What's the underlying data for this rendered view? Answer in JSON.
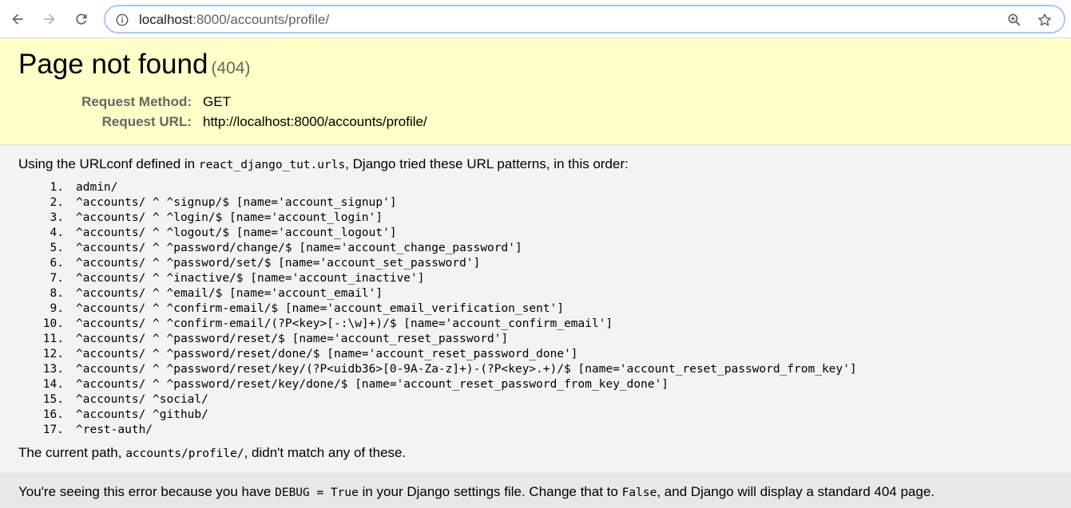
{
  "browser": {
    "back_icon": "arrow-left-icon",
    "forward_icon": "arrow-right-icon",
    "reload_icon": "reload-icon",
    "url_host": "localhost",
    "url_rest": ":8000/accounts/profile/",
    "info_icon": "info-icon",
    "zoom_icon": "zoom-icon",
    "bookmark_icon": "star-icon"
  },
  "summary": {
    "title": "Page not found",
    "status_code": "(404)",
    "request_method_label": "Request Method:",
    "request_method_value": "GET",
    "request_url_label": "Request URL:",
    "request_url_value": "http://localhost:8000/accounts/profile/"
  },
  "info": {
    "intro_before": "Using the URLconf defined in ",
    "intro_module": "react_django_tut.urls",
    "intro_after": ", Django tried these URL patterns, in this order:",
    "patterns": [
      "admin/",
      "^accounts/ ^ ^signup/$ [name='account_signup']",
      "^accounts/ ^ ^login/$ [name='account_login']",
      "^accounts/ ^ ^logout/$ [name='account_logout']",
      "^accounts/ ^ ^password/change/$ [name='account_change_password']",
      "^accounts/ ^ ^password/set/$ [name='account_set_password']",
      "^accounts/ ^ ^inactive/$ [name='account_inactive']",
      "^accounts/ ^ ^email/$ [name='account_email']",
      "^accounts/ ^ ^confirm-email/$ [name='account_email_verification_sent']",
      "^accounts/ ^ ^confirm-email/(?P<key>[-:\\w]+)/$ [name='account_confirm_email']",
      "^accounts/ ^ ^password/reset/$ [name='account_reset_password']",
      "^accounts/ ^ ^password/reset/done/$ [name='account_reset_password_done']",
      "^accounts/ ^ ^password/reset/key/(?P<uidb36>[0-9A-Za-z]+)-(?P<key>.+)/$ [name='account_reset_password_from_key']",
      "^accounts/ ^ ^password/reset/key/done/$ [name='account_reset_password_from_key_done']",
      "^accounts/ ^social/",
      "^accounts/ ^github/",
      "^rest-auth/"
    ],
    "current_before": "The current path, ",
    "current_path": "accounts/profile/",
    "current_after": ", didn't match any of these."
  },
  "explanation": {
    "before": "You're seeing this error because you have ",
    "debug_code": "DEBUG = True",
    "middle": " in your Django settings file. Change that to ",
    "false_code": "False",
    "after": ", and Django will display a standard 404 page."
  }
}
